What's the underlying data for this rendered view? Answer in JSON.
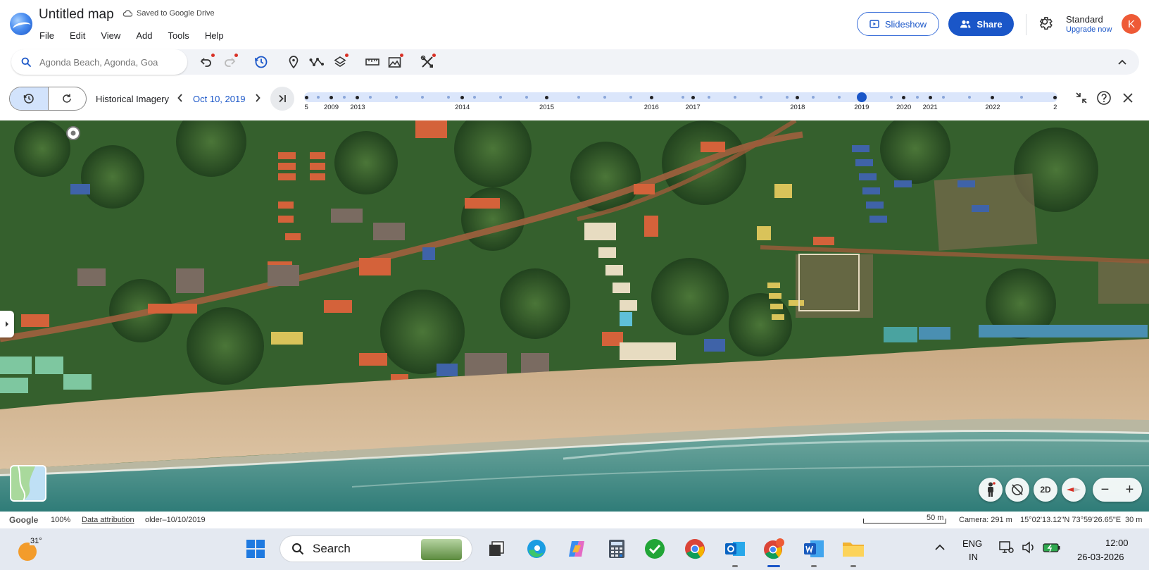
{
  "header": {
    "title": "Untitled map",
    "save_status": "Saved to Google Drive",
    "menu": [
      "File",
      "Edit",
      "View",
      "Add",
      "Tools",
      "Help"
    ],
    "slideshow_label": "Slideshow",
    "share_label": "Share",
    "plan_name": "Standard",
    "upgrade_label": "Upgrade now",
    "avatar_initial": "K"
  },
  "toolbar": {
    "search_value": "Agonda Beach, Agonda, Goa"
  },
  "history": {
    "label": "Historical Imagery",
    "current_date": "Oct 10, 2019",
    "timeline_years": [
      {
        "label": "5",
        "pos": 0.003
      },
      {
        "label": "2009",
        "pos": 0.036
      },
      {
        "label": "2013",
        "pos": 0.071
      },
      {
        "label": "2014",
        "pos": 0.21
      },
      {
        "label": "2015",
        "pos": 0.322
      },
      {
        "label": "2016",
        "pos": 0.461
      },
      {
        "label": "2017",
        "pos": 0.516
      },
      {
        "label": "2018",
        "pos": 0.655
      },
      {
        "label": "2019",
        "pos": 0.74
      },
      {
        "label": "2020",
        "pos": 0.796
      },
      {
        "label": "2021",
        "pos": 0.831
      },
      {
        "label": "2022",
        "pos": 0.914
      },
      {
        "label": "2",
        "pos": 0.997
      }
    ],
    "selected_pos": 0.74
  },
  "map_controls": {
    "mode_2d": "2D",
    "zoom_out": "−",
    "zoom_in": "+"
  },
  "status": {
    "brand": "Google",
    "zoom": "100%",
    "attribution": "Data attribution",
    "imagery": "older–10/10/2019",
    "scale": "50 m",
    "camera": "Camera: 291 m",
    "coordinates": "15°02'13.12\"N 73°59'26.65\"E",
    "elevation": "30 m"
  },
  "taskbar": {
    "temperature": "31°",
    "search_label": "Search",
    "lang_1": "ENG",
    "lang_2": "IN",
    "time": "12:00",
    "date": "26-03-2026",
    "chrome_badge": "K"
  },
  "colors": {
    "accent": "#1a56c8",
    "avatar": "#ee5a36",
    "timeline_track": "#dbe6fb"
  }
}
